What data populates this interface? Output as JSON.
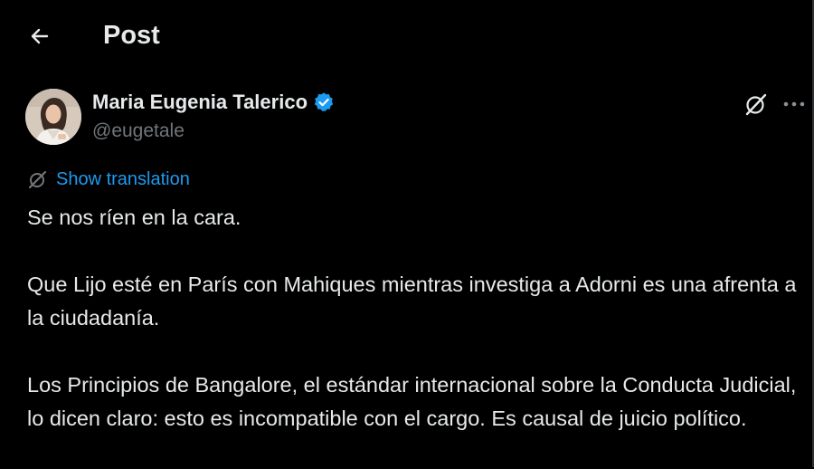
{
  "header": {
    "title": "Post",
    "back_icon": "arrow-left-icon"
  },
  "author": {
    "name": "Maria Eugenia Talerico",
    "handle": "@eugetale",
    "verified": true,
    "verified_color": "#1d9bf0"
  },
  "actions": {
    "grok_icon": "grok-slash-icon",
    "more_icon": "more-horizontal-icon"
  },
  "translation": {
    "label": "Show translation",
    "icon": "translate-slash-icon",
    "color": "#1d9bf0"
  },
  "post": {
    "paragraphs": [
      "Se nos ríen en la cara.",
      "Que Lijo esté en París con Mahiques mientras investiga a Adorni es una afrenta a la ciudadanía.",
      "Los Principios de Bangalore, el estándar internacional sobre la Conducta Judicial, lo dicen claro: esto es incompatible con el cargo. Es causal de juicio político."
    ]
  },
  "colors": {
    "background": "#000000",
    "text": "#e7e9ea",
    "secondary_text": "#71767b",
    "accent": "#1d9bf0"
  }
}
